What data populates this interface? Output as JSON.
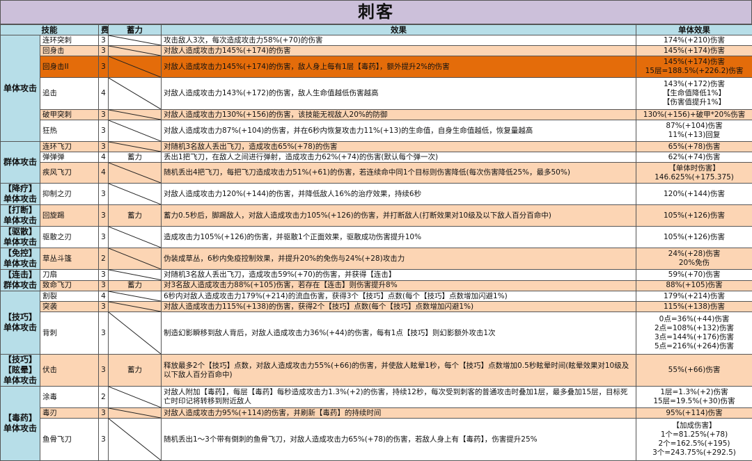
{
  "title": "刺客",
  "headers": {
    "skill": "技能",
    "cost": "费",
    "charge": "蓄力",
    "effect": "效果",
    "single": "单体效果"
  },
  "colors": {
    "title_bg": "#ccc0da",
    "header_bg": "#b7dee8",
    "peach": "#fcd5b4",
    "orange": "#e46c0a"
  },
  "groups": [
    {
      "label": [
        "单体攻击"
      ],
      "rows": 6
    },
    {
      "label": [
        "群体攻击"
      ],
      "rows": 3
    },
    {
      "label": [
        "【降疗】",
        "单体攻击"
      ],
      "rows": 1
    },
    {
      "label": [
        "【打断】",
        "单体攻击"
      ],
      "rows": 1
    },
    {
      "label": [
        "【驱散】",
        "单体攻击"
      ],
      "rows": 1
    },
    {
      "label": [
        "【免控】",
        "单体攻击"
      ],
      "rows": 1
    },
    {
      "label": [
        "【连击】",
        "群体攻击"
      ],
      "rows": 2
    },
    {
      "label": [
        "【技巧】",
        "单体攻击"
      ],
      "rows": 3
    },
    {
      "label": [
        "【技巧】",
        "【眩晕】",
        "单体攻击"
      ],
      "rows": 1
    },
    {
      "label": [
        "【毒药】",
        "单体攻击"
      ],
      "rows": 3
    }
  ],
  "skills": [
    {
      "name": "连环突刺",
      "cost": "3",
      "charge": "",
      "style": "white",
      "effect": "攻击敌人3次，每次造成攻击力58%(+70)的伤害",
      "single": [
        "174%(+210)伤害"
      ]
    },
    {
      "name": "回身击",
      "cost": "3",
      "charge": "",
      "style": "peach",
      "effect": "对敌人造成攻击力145%(+174)的伤害",
      "single": [
        "145%(+174)伤害"
      ]
    },
    {
      "name": "回身击II",
      "cost": "3",
      "charge": "",
      "style": "orange",
      "effect": "对敌人造成攻击力145%(+174)的伤害，敌人身上每有1层【毒药】，额外提升2%的伤害",
      "single": [
        "145%(+174)伤害",
        "15层=188.5%(+226.2)伤害"
      ]
    },
    {
      "name": "追击",
      "cost": "4",
      "charge": "",
      "style": "white",
      "effect": "对敌人造成攻击力143%(+172)的伤害，敌人生命值越低伤害越高",
      "single": [
        "143%(+172)伤害",
        "【生命值降低1%】",
        "【伤害值提升1%】"
      ]
    },
    {
      "name": "破甲突刺",
      "cost": "3",
      "charge": "",
      "style": "peach",
      "effect": "对敌人造成攻击力130%(+156)的伤害，该技能无视敌人20%的防御",
      "single": [
        "130%(+156)+破甲*20%伤害"
      ]
    },
    {
      "name": "狂热",
      "cost": "3",
      "charge": "",
      "style": "white",
      "effect": "对敌人造成攻击力87%(+104)的伤害，并在6秒内恢复攻击力11%(+13)的生命值，自身生命值越低，恢复量越高",
      "single": [
        "87%(+104)伤害",
        "11%(+13)回复"
      ]
    },
    {
      "name": "连环飞刀",
      "cost": "3",
      "charge": "",
      "style": "peach",
      "effect": "对随机3名敌人丢出飞刀，造成攻击65%(+78)的伤害",
      "single": [
        "65%(+78)伤害"
      ]
    },
    {
      "name": "弹弹弹",
      "cost": "4",
      "charge": "蓄力",
      "style": "white",
      "effect": "丢出1把飞刀，在敌人之间进行弹射，造成攻击力62%(+74)的伤害(默认每个弹一次)",
      "single": [
        "62%(+74)伤害"
      ]
    },
    {
      "name": "疾风飞刀",
      "cost": "4",
      "charge": "",
      "style": "peach",
      "effect": "随机丢出4把飞刀，每把飞刀造成攻击力51%(+61)的伤害，若连续命中同1个目标则伤害降低(每次伤害降低25%，最多50%)",
      "single": [
        "【单体时伤害】",
        "146.625%(+175.375)"
      ]
    },
    {
      "name": "抑制之刃",
      "cost": "3",
      "charge": "",
      "style": "white",
      "effect": "对敌人造成攻击力120%(+144)的伤害，并降低敌人16%的治疗效果，持续6秒",
      "single": [
        "120%(+144)伤害"
      ]
    },
    {
      "name": "回旋踢",
      "cost": "3",
      "charge": "蓄力",
      "style": "peach",
      "effect": "蓄力0.5秒后，脚踢敌人，对敌人造成攻击力105%(+126)的伤害，并打断敌人(打断效果对10级及以下敌人百分百命中)",
      "single": [
        "105%(+126)伤害"
      ]
    },
    {
      "name": "驱散之刃",
      "cost": "3",
      "charge": "",
      "style": "white",
      "effect": "造成攻击力105%(+126)的伤害，并驱散1个正面效果，驱散成功伤害提升10%",
      "single": [
        "105%(+126)伤害"
      ]
    },
    {
      "name": "草丛斗篷",
      "cost": "2",
      "charge": "",
      "style": "peach",
      "effect": "伪装成草丛，6秒内免疫控制效果，并提升20%的免伤与24%(+28)攻击力",
      "single": [
        "24%(+28)伤害",
        "20%免伤"
      ]
    },
    {
      "name": "刀扇",
      "cost": "3",
      "charge": "",
      "style": "white",
      "effect": "对随机3名敌人丢出飞刀，造成攻击59%(+70)的伤害，并获得【连击】",
      "single": [
        "59%(+70)伤害"
      ]
    },
    {
      "name": "致命飞刀",
      "cost": "3",
      "charge": "蓄力",
      "style": "peach",
      "effect": "对3名敌人造成攻击力88%(+105)伤害，若存在【连击】则伤害提升8%",
      "single": [
        "88%(+105)伤害"
      ]
    },
    {
      "name": "割裂",
      "cost": "4",
      "charge": "",
      "style": "white",
      "effect": "6秒内对敌人造成攻击力179%(+214)的流血伤害，获得3个【技巧】点数(每个【技巧】点数增加闪避1%)",
      "single": [
        "179%(+214)伤害"
      ]
    },
    {
      "name": "突袭",
      "cost": "3",
      "charge": "",
      "style": "peach",
      "effect": "对敌人造成攻击力115%(+138)的伤害，获得2个【技巧】点数(每个【技巧】点数增加闪避1%)",
      "single": [
        "115%(+138)伤害"
      ]
    },
    {
      "name": "背刺",
      "cost": "3",
      "charge": "",
      "style": "white",
      "effect": "制造幻影瞬移到敌人背后，对敌人造成攻击力36%(+44)的伤害，每有1点【技巧】则幻影额外攻击1次",
      "single": [
        "0点=36%(+44)伤害",
        "2点=108%(+132)伤害",
        "3点=144%(+176)伤害",
        "5点=216%(+264)伤害"
      ]
    },
    {
      "name": "伏击",
      "cost": "3",
      "charge": "蓄力",
      "style": "peach",
      "effect": "释放最多2个【技巧】点数，对敌人造成攻击力55%(+66)的伤害，并使敌人眩晕1秒，每个【技巧】点数增加0.5秒眩晕时间(眩晕效果对10级及以下敌人百分百命中)",
      "single": [
        "55%(+66)伤害"
      ]
    },
    {
      "name": "涂毒",
      "cost": "2",
      "charge": "",
      "style": "white",
      "effect": "对敌人附加【毒药】，每层【毒药】每秒造成攻击力1.3%(+2)的伤害，持续12秒，每次受到刺客的普通攻击时叠加1层，最多叠加15层，目标死亡时印记将转移到附近敌人",
      "single": [
        "1层=1.3%(+2)伤害",
        "15层=19.5%(+30)伤害"
      ]
    },
    {
      "name": "毒刃",
      "cost": "3",
      "charge": "",
      "style": "peach",
      "effect": "对敌人造成攻击力95%(+114)的伤害，并刷新【毒药】的持续时间",
      "single": [
        "95%(+114)伤害"
      ]
    },
    {
      "name": "鱼骨飞刀",
      "cost": "3",
      "charge": "",
      "style": "white",
      "effect": "随机丢出1～3个带有倒刺的鱼骨飞刀，对敌人造成攻击力65%(+78)的伤害，若敌人身上有【毒药】，伤害提升25%",
      "single": [
        "【加成伤害】",
        "1个=81.25%(+78)",
        "2个=162.5%(+195)",
        "3个=243.75%(+292.5)"
      ]
    }
  ]
}
